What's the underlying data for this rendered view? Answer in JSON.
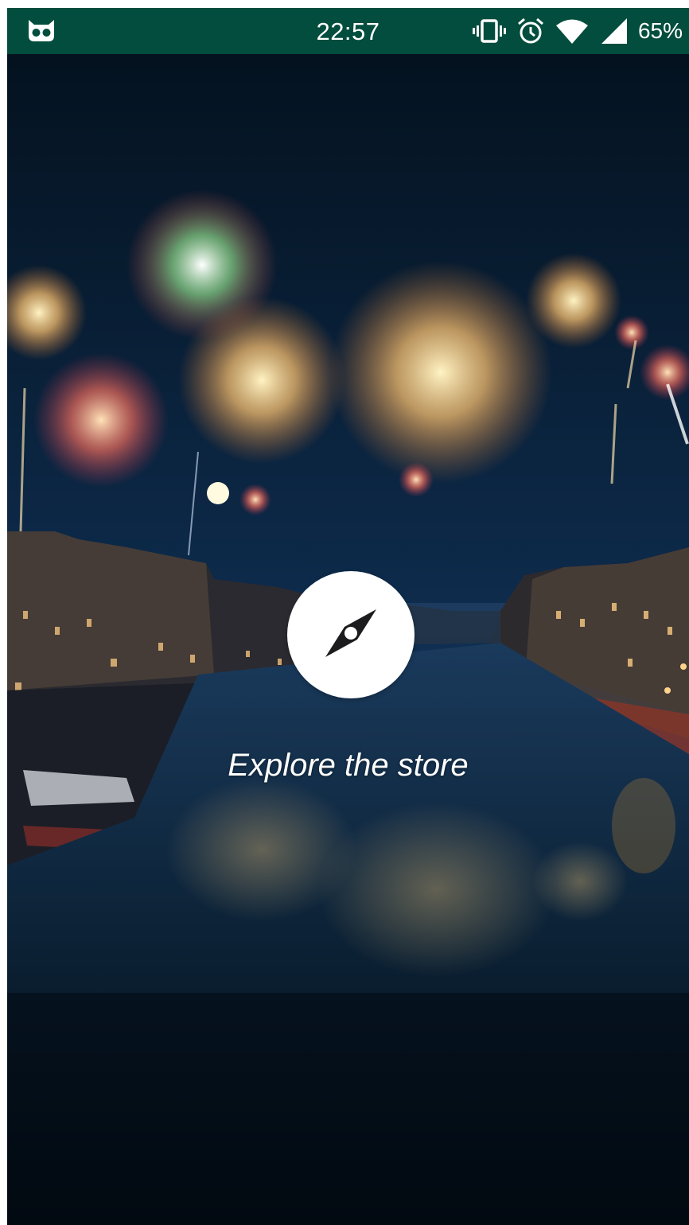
{
  "status_bar": {
    "time": "22:57",
    "battery": "65%",
    "left_icon": "owl-notification-icon",
    "right_icons": [
      "vibrate-icon",
      "alarm-icon",
      "wifi-icon",
      "cell-signal-icon"
    ],
    "background_color": "#024d3d"
  },
  "splash": {
    "background_image": "venice-canal-fireworks-night",
    "button_icon": "compass-icon",
    "caption": "Explore the store"
  }
}
